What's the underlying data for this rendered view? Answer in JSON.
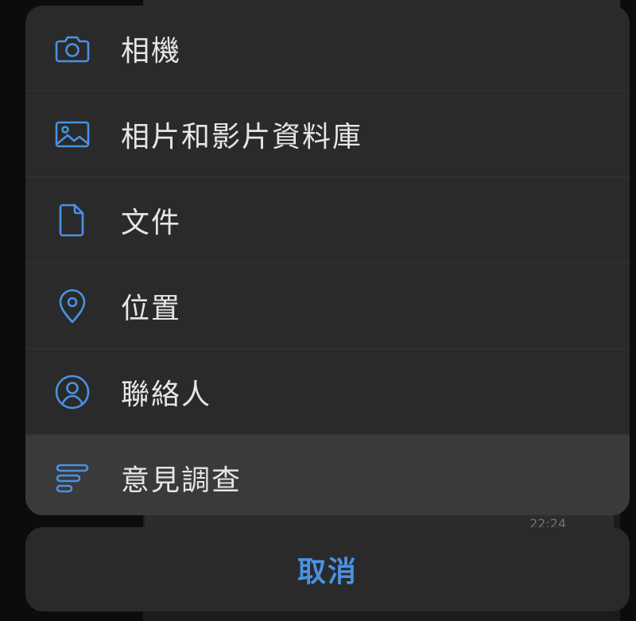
{
  "sheet": {
    "items": [
      {
        "label": "相機",
        "icon": "camera-icon"
      },
      {
        "label": "相片和影片資料庫",
        "icon": "photo-library-icon"
      },
      {
        "label": "文件",
        "icon": "document-icon"
      },
      {
        "label": "位置",
        "icon": "location-pin-icon"
      },
      {
        "label": "聯絡人",
        "icon": "contact-icon"
      },
      {
        "label": "意見調查",
        "icon": "poll-icon",
        "highlighted": true
      }
    ]
  },
  "cancel": {
    "label": "取消"
  },
  "background": {
    "timestamp": "22:24"
  },
  "colors": {
    "accent": "#4a92e2",
    "sheet": "#2a2a2b",
    "text": "#e6e6e6"
  }
}
